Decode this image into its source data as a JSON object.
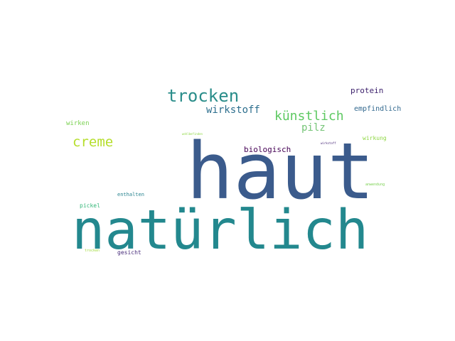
{
  "word_cloud": {
    "words": [
      {
        "text": "haut",
        "color": "#3b5b8c"
      },
      {
        "text": "natürlich",
        "color": "#23888e"
      },
      {
        "text": "trocken",
        "color": "#2a8d8a"
      },
      {
        "text": "creme",
        "color": "#b5de2b"
      },
      {
        "text": "künstlich",
        "color": "#5ec962"
      },
      {
        "text": "wirkstoff",
        "color": "#2d6f8e"
      },
      {
        "text": "pilz",
        "color": "#74c476"
      },
      {
        "text": "protein",
        "color": "#3b1f6b"
      },
      {
        "text": "empfindlich",
        "color": "#31688e"
      },
      {
        "text": "biologisch",
        "color": "#440154"
      },
      {
        "text": "wirken",
        "color": "#7ad151"
      },
      {
        "text": "wirkung",
        "color": "#8fd744"
      },
      {
        "text": "anwendung",
        "color": "#7ad151"
      },
      {
        "text": "enthalten",
        "color": "#26828e"
      },
      {
        "text": "pickel",
        "color": "#35b779"
      },
      {
        "text": "gesicht",
        "color": "#472c7a"
      },
      {
        "text": "trocken",
        "color": "#a0da39"
      },
      {
        "text": "wirkstoff",
        "color": "#482878"
      },
      {
        "text": "wohlbefinden",
        "color": "#8fd744"
      }
    ]
  }
}
